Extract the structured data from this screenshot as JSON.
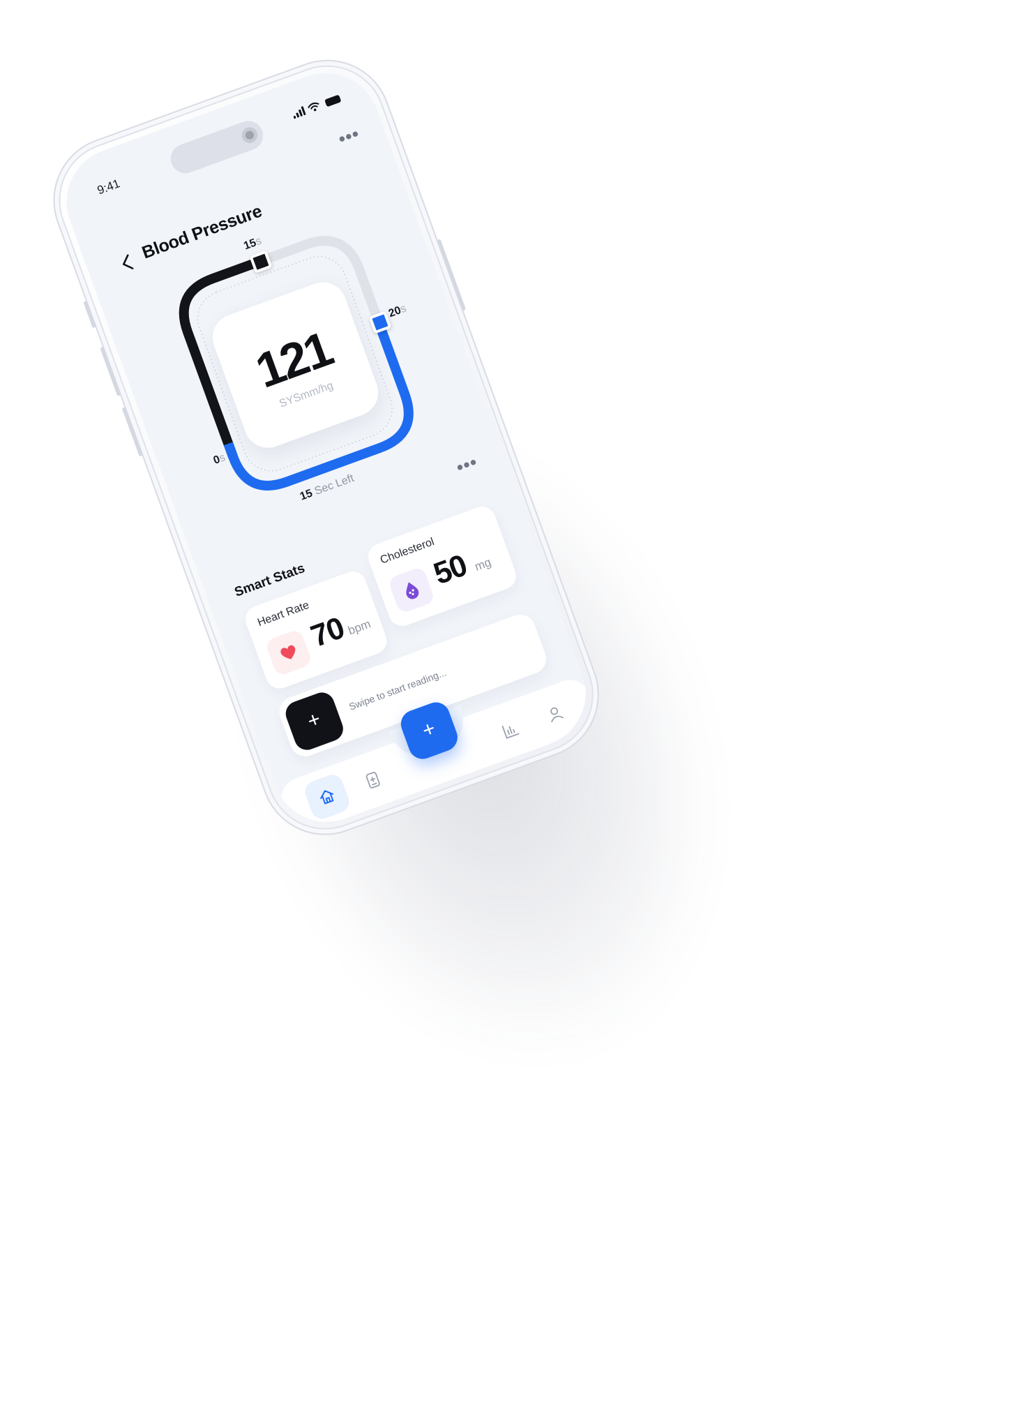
{
  "status": {
    "time": "9:41"
  },
  "header": {
    "title": "Blood Pressure"
  },
  "gauge": {
    "label_start": "0",
    "label_mid": "15",
    "label_end": "20",
    "unit_suffix": "s",
    "value": "121",
    "unit": "SYSmm/hg",
    "time_left_number": "15",
    "time_left_text": "Sec Left",
    "progress_fraction": 0.75
  },
  "stats": {
    "title": "Smart Stats",
    "heart_rate": {
      "label": "Heart Rate",
      "value": "70",
      "unit": "bpm"
    },
    "cholesterol": {
      "label": "Cholesterol",
      "value": "50",
      "unit": "mg"
    }
  },
  "swipe": {
    "button_label": "+",
    "placeholder": "Swipe to start reading..."
  },
  "nav": {
    "fab_label": "+",
    "items": [
      "home-icon",
      "medical-card-icon",
      "chart-icon",
      "profile-icon"
    ],
    "active_color": "#1e6bf0",
    "active_bg": "#e8f1fe"
  },
  "colors": {
    "accent": "#1e6bf0",
    "dark": "#12141a",
    "track": "#dfe2e8",
    "heart": "#ef4b5c",
    "cholesterol": "#7c4bd8"
  }
}
